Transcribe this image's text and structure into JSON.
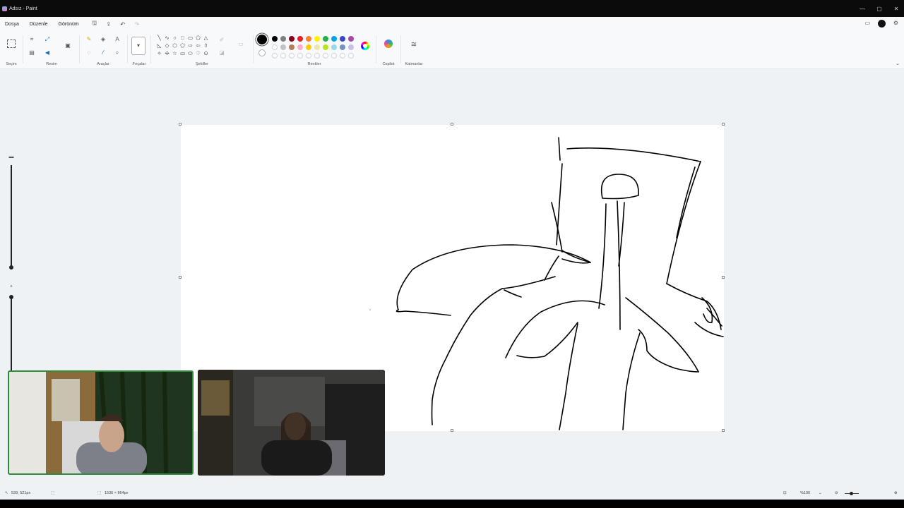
{
  "window": {
    "title": "Adsız - Paint",
    "controls": {
      "minimize": "—",
      "maximize": "▢",
      "close": "✕"
    }
  },
  "menu": {
    "items": [
      "Dosya",
      "Düzenle",
      "Görünüm"
    ],
    "quick_access": [
      "save-icon",
      "share-icon",
      "undo-icon",
      "redo-icon"
    ],
    "right_icons": [
      "comment-icon",
      "profile-icon",
      "settings-icon"
    ]
  },
  "ribbon": {
    "groups": {
      "selection": "Seçim",
      "image": "Resim",
      "tools": "Araçlar",
      "brushes": "Fırçalar",
      "shapes": "Şekiller",
      "colors": "Renkler",
      "copilot": "Copilot",
      "layers": "Katmanlar"
    },
    "shapes": [
      "╲",
      "∿",
      "○",
      "□",
      "▭",
      "⬠",
      "△",
      "◺",
      "◇",
      "⬡",
      "⬠",
      "⇨",
      "⇦",
      "⇧",
      "✧",
      "✢",
      "☆",
      "▭",
      "⬭",
      "♡",
      "⊙"
    ],
    "palette_row1": [
      "#000000",
      "#7f7f7f",
      "#880015",
      "#ed1c24",
      "#ff7f27",
      "#fff200",
      "#22b14c",
      "#00a2e8",
      "#3f48cc",
      "#a349a4"
    ],
    "palette_row2": [
      "#ffffff",
      "#c3c3c3",
      "#b97a57",
      "#ffaec9",
      "#ffc90e",
      "#efe4b0",
      "#b5e61d",
      "#99d9ea",
      "#7092be",
      "#c8bfe7"
    ],
    "palette_row3_count": 10,
    "current_color": "#000000"
  },
  "status": {
    "cursor_position": "539, 521px",
    "canvas_size": "1536 × 864px",
    "zoom": "%100"
  },
  "accent": "#2f8a3a"
}
